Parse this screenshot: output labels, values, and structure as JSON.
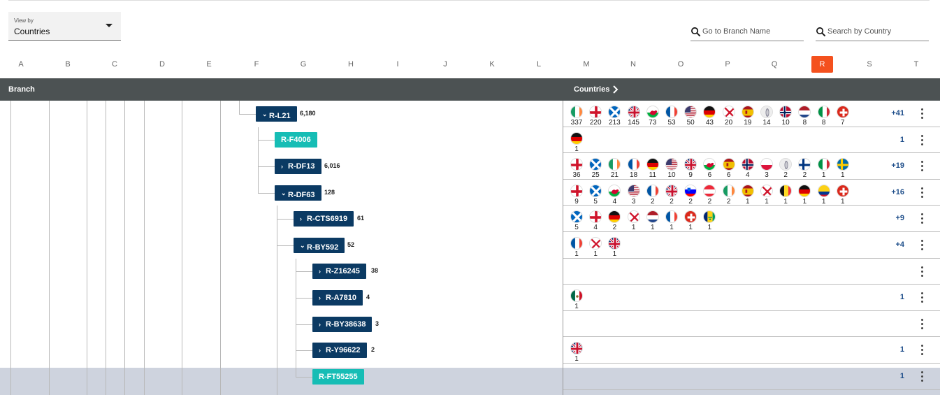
{
  "topbar": {
    "view_by_label": "View by",
    "view_by_value": "Countries"
  },
  "search": {
    "branch_placeholder": "Go to Branch Name",
    "country_placeholder": "Search by Country"
  },
  "letters": [
    "A",
    "B",
    "C",
    "D",
    "E",
    "F",
    "G",
    "H",
    "I",
    "J",
    "K",
    "L",
    "M",
    "N",
    "O",
    "P",
    "Q",
    "R",
    "S",
    "T"
  ],
  "active_letter": "R",
  "header": {
    "branch": "Branch",
    "countries": "Countries"
  },
  "colors": {
    "accent": "#f4511e",
    "node": "#0b3a63",
    "node_teal": "#16bdb5",
    "header": "#4c5253",
    "highlight": "#ced3de",
    "more_link": "#1e4e8a"
  },
  "nodes": [
    {
      "name": "R-L21",
      "count": "6,180",
      "expanded": true,
      "teal": false
    },
    {
      "name": "R-F4006",
      "count": "",
      "expanded": false,
      "teal": true
    },
    {
      "name": "R-DF13",
      "count": "6,016",
      "expanded": false,
      "teal": false
    },
    {
      "name": "R-DF63",
      "count": "128",
      "expanded": true,
      "teal": false
    },
    {
      "name": "R-CTS6919",
      "count": "61",
      "expanded": false,
      "teal": false
    },
    {
      "name": "R-BY592",
      "count": "52",
      "expanded": true,
      "teal": false
    },
    {
      "name": "R-Z16245",
      "count": "38",
      "expanded": false,
      "teal": false
    },
    {
      "name": "R-A7810",
      "count": "4",
      "expanded": false,
      "teal": false
    },
    {
      "name": "R-BY38638",
      "count": "3",
      "expanded": false,
      "teal": false
    },
    {
      "name": "R-Y96622",
      "count": "2",
      "expanded": false,
      "teal": false
    },
    {
      "name": "R-FT55255",
      "count": "",
      "expanded": false,
      "teal": true
    }
  ],
  "rows": [
    {
      "more": "+41",
      "flags": [
        [
          "ireland",
          "337"
        ],
        [
          "england",
          "220"
        ],
        [
          "scotland",
          "213"
        ],
        [
          "uk",
          "145"
        ],
        [
          "wales",
          "73"
        ],
        [
          "france",
          "53"
        ],
        [
          "usa",
          "50"
        ],
        [
          "germany",
          "43"
        ],
        [
          "northern-ireland",
          "20"
        ],
        [
          "spain",
          "19"
        ],
        [
          "unknown",
          "14"
        ],
        [
          "norway",
          "10"
        ],
        [
          "netherlands",
          "8"
        ],
        [
          "italy",
          "8"
        ],
        [
          "switzerland",
          "7"
        ]
      ]
    },
    {
      "more": "1",
      "flags": [
        [
          "germany",
          "1"
        ]
      ]
    },
    {
      "more": "+19",
      "flags": [
        [
          "england",
          "36"
        ],
        [
          "scotland",
          "25"
        ],
        [
          "ireland",
          "21"
        ],
        [
          "france",
          "18"
        ],
        [
          "germany",
          "11"
        ],
        [
          "usa",
          "10"
        ],
        [
          "uk",
          "9"
        ],
        [
          "wales",
          "6"
        ],
        [
          "spain",
          "6"
        ],
        [
          "norway",
          "4"
        ],
        [
          "poland",
          "3"
        ],
        [
          "unknown",
          "2"
        ],
        [
          "finland",
          "2"
        ],
        [
          "italy",
          "1"
        ],
        [
          "sweden",
          "1"
        ]
      ]
    },
    {
      "more": "+16",
      "flags": [
        [
          "england",
          "9"
        ],
        [
          "scotland",
          "5"
        ],
        [
          "wales",
          "4"
        ],
        [
          "usa",
          "3"
        ],
        [
          "france",
          "2"
        ],
        [
          "uk",
          "2"
        ],
        [
          "slovenia",
          "2"
        ],
        [
          "austria",
          "2"
        ],
        [
          "ireland",
          "2"
        ],
        [
          "spain",
          "1"
        ],
        [
          "northern-ireland",
          "1"
        ],
        [
          "belgium",
          "1"
        ],
        [
          "germany",
          "1"
        ],
        [
          "colombia",
          "1"
        ],
        [
          "switzerland",
          "1"
        ]
      ]
    },
    {
      "more": "+9",
      "flags": [
        [
          "scotland",
          "5"
        ],
        [
          "england",
          "4"
        ],
        [
          "germany",
          "2"
        ],
        [
          "northern-ireland",
          "1"
        ],
        [
          "netherlands",
          "1"
        ],
        [
          "france",
          "1"
        ],
        [
          "switzerland",
          "1"
        ],
        [
          "saint-vincent",
          "1"
        ]
      ]
    },
    {
      "more": "+4",
      "flags": [
        [
          "france",
          "1"
        ],
        [
          "northern-ireland",
          "1"
        ],
        [
          "uk",
          "1"
        ]
      ]
    },
    {
      "more": "",
      "flags": []
    },
    {
      "more": "1",
      "flags": [
        [
          "mexico",
          "1"
        ]
      ]
    },
    {
      "more": "",
      "flags": []
    },
    {
      "more": "1",
      "flags": [
        [
          "uk",
          "1"
        ]
      ]
    },
    {
      "more": "1",
      "flags": []
    }
  ]
}
